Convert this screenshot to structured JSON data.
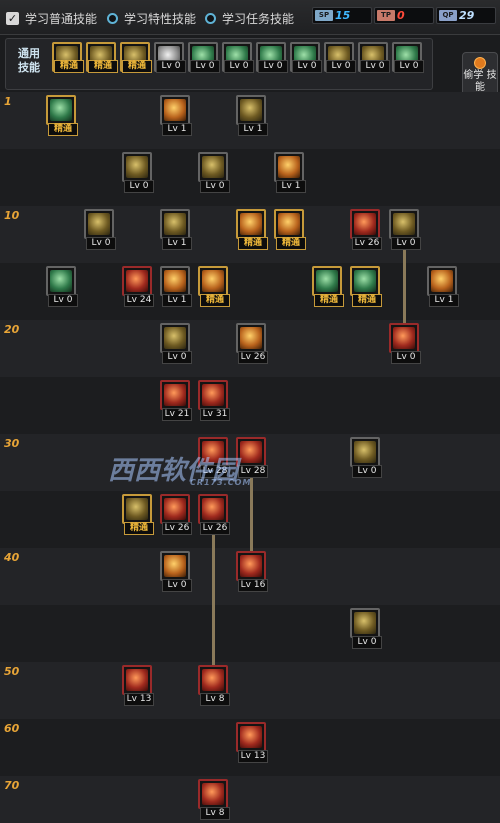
{
  "header": {
    "options": [
      {
        "label": "学习普通技能",
        "selected": true
      },
      {
        "label": "学习特性技能",
        "selected": false
      },
      {
        "label": "学习任务技能",
        "selected": false
      }
    ],
    "counters": [
      {
        "label": "SP",
        "value": "15",
        "color": "#3fb8ff",
        "badge": "#7fa8c8"
      },
      {
        "label": "TP",
        "value": "0",
        "color": "#ff4a3a",
        "badge": "#c87a6a"
      },
      {
        "label": "QP",
        "value": "29",
        "color": "#bfe0ff",
        "badge": "#8aa0c8"
      }
    ]
  },
  "common": {
    "label": "通用 技能",
    "skills": [
      {
        "tag": "精通",
        "art": "g"
      },
      {
        "tag": "精通",
        "art": "g"
      },
      {
        "tag": "精通",
        "art": "g"
      },
      {
        "tag": "Lv 0",
        "art": "w"
      },
      {
        "tag": "Lv 0",
        "art": "t"
      },
      {
        "tag": "Lv 0",
        "art": "t"
      },
      {
        "tag": "Lv 0",
        "art": "t"
      },
      {
        "tag": "Lv 0",
        "art": "t"
      },
      {
        "tag": "Lv 0",
        "art": "g"
      },
      {
        "tag": "Lv 0",
        "art": "g"
      },
      {
        "tag": "Lv 0",
        "art": "t"
      }
    ]
  },
  "side_button": {
    "label": "偷学 技能"
  },
  "level_labels": [
    {
      "row": 0,
      "text": "1"
    },
    {
      "row": 2,
      "text": "10"
    },
    {
      "row": 4,
      "text": "20"
    },
    {
      "row": 6,
      "text": "30"
    },
    {
      "row": 8,
      "text": "40"
    },
    {
      "row": 10,
      "text": "50"
    },
    {
      "row": 11,
      "text": "60"
    },
    {
      "row": 12,
      "text": "70"
    }
  ],
  "tree": [
    {
      "row": 0,
      "col": 0,
      "tag": "精通",
      "art": "t",
      "frame": "gold"
    },
    {
      "row": 0,
      "col": 3,
      "tag": "Lv 1",
      "art": "o",
      "frame": "plain"
    },
    {
      "row": 0,
      "col": 5,
      "tag": "Lv 1",
      "art": "g",
      "frame": "plain"
    },
    {
      "row": 1,
      "col": 2,
      "tag": "Lv 0",
      "art": "g",
      "frame": "plain"
    },
    {
      "row": 1,
      "col": 4,
      "tag": "Lv 0",
      "art": "g",
      "frame": "plain"
    },
    {
      "row": 1,
      "col": 6,
      "tag": "Lv 1",
      "art": "o",
      "frame": "plain"
    },
    {
      "row": 2,
      "col": 1,
      "tag": "Lv 0",
      "art": "g",
      "frame": "plain"
    },
    {
      "row": 2,
      "col": 3,
      "tag": "Lv 1",
      "art": "g",
      "frame": "plain"
    },
    {
      "row": 2,
      "col": 5,
      "tag": "精通",
      "art": "o",
      "frame": "gold"
    },
    {
      "row": 2,
      "col": 6,
      "tag": "精通",
      "art": "o",
      "frame": "gold"
    },
    {
      "row": 2,
      "col": 8,
      "tag": "Lv 26",
      "art": "r",
      "frame": "red"
    },
    {
      "row": 2,
      "col": 9,
      "tag": "Lv 0",
      "art": "g",
      "frame": "plain"
    },
    {
      "row": 3,
      "col": 0,
      "tag": "Lv 0",
      "art": "t",
      "frame": "plain"
    },
    {
      "row": 3,
      "col": 2,
      "tag": "Lv 24",
      "art": "r",
      "frame": "red"
    },
    {
      "row": 3,
      "col": 3,
      "tag": "Lv 1",
      "art": "o",
      "frame": "plain"
    },
    {
      "row": 3,
      "col": 4,
      "tag": "精通",
      "art": "o",
      "frame": "gold"
    },
    {
      "row": 3,
      "col": 7,
      "tag": "精通",
      "art": "t",
      "frame": "gold"
    },
    {
      "row": 3,
      "col": 8,
      "tag": "精通",
      "art": "t",
      "frame": "gold"
    },
    {
      "row": 3,
      "col": 10,
      "tag": "Lv 1",
      "art": "o",
      "frame": "plain"
    },
    {
      "row": 4,
      "col": 3,
      "tag": "Lv 0",
      "art": "g",
      "frame": "plain"
    },
    {
      "row": 4,
      "col": 5,
      "tag": "Lv 26",
      "art": "o",
      "frame": "plain"
    },
    {
      "row": 4,
      "col": 9,
      "tag": "Lv 0",
      "art": "r",
      "frame": "red"
    },
    {
      "row": 5,
      "col": 3,
      "tag": "Lv 21",
      "art": "r",
      "frame": "red"
    },
    {
      "row": 5,
      "col": 4,
      "tag": "Lv 31",
      "art": "r",
      "frame": "red"
    },
    {
      "row": 6,
      "col": 4,
      "tag": "Lv 28",
      "art": "r",
      "frame": "red"
    },
    {
      "row": 6,
      "col": 5,
      "tag": "Lv 28",
      "art": "r",
      "frame": "red"
    },
    {
      "row": 6,
      "col": 8,
      "tag": "Lv 0",
      "art": "g",
      "frame": "plain"
    },
    {
      "row": 7,
      "col": 2,
      "tag": "精通",
      "art": "g",
      "frame": "gold"
    },
    {
      "row": 7,
      "col": 3,
      "tag": "Lv 26",
      "art": "r",
      "frame": "red"
    },
    {
      "row": 7,
      "col": 4,
      "tag": "Lv 26",
      "art": "r",
      "frame": "red"
    },
    {
      "row": 8,
      "col": 3,
      "tag": "Lv 0",
      "art": "o",
      "frame": "plain"
    },
    {
      "row": 8,
      "col": 5,
      "tag": "Lv 16",
      "art": "r",
      "frame": "red"
    },
    {
      "row": 9,
      "col": 8,
      "tag": "Lv 0",
      "art": "g",
      "frame": "plain"
    },
    {
      "row": 10,
      "col": 2,
      "tag": "Lv 13",
      "art": "r",
      "frame": "red"
    },
    {
      "row": 10,
      "col": 4,
      "tag": "Lv 8",
      "art": "r",
      "frame": "red"
    },
    {
      "row": 11,
      "col": 5,
      "tag": "Lv 13",
      "art": "r",
      "frame": "red"
    },
    {
      "row": 12,
      "col": 4,
      "tag": "Lv 8",
      "art": "r",
      "frame": "red"
    }
  ],
  "connectors": [
    {
      "col": 9,
      "from_row": 2,
      "to_row": 4
    },
    {
      "col": 5,
      "from_row": 6,
      "to_row": 8
    },
    {
      "col": 4,
      "from_row": 7,
      "to_row": 10
    }
  ],
  "watermark": {
    "text": "西西软件园",
    "sub": "CR173.COM"
  }
}
